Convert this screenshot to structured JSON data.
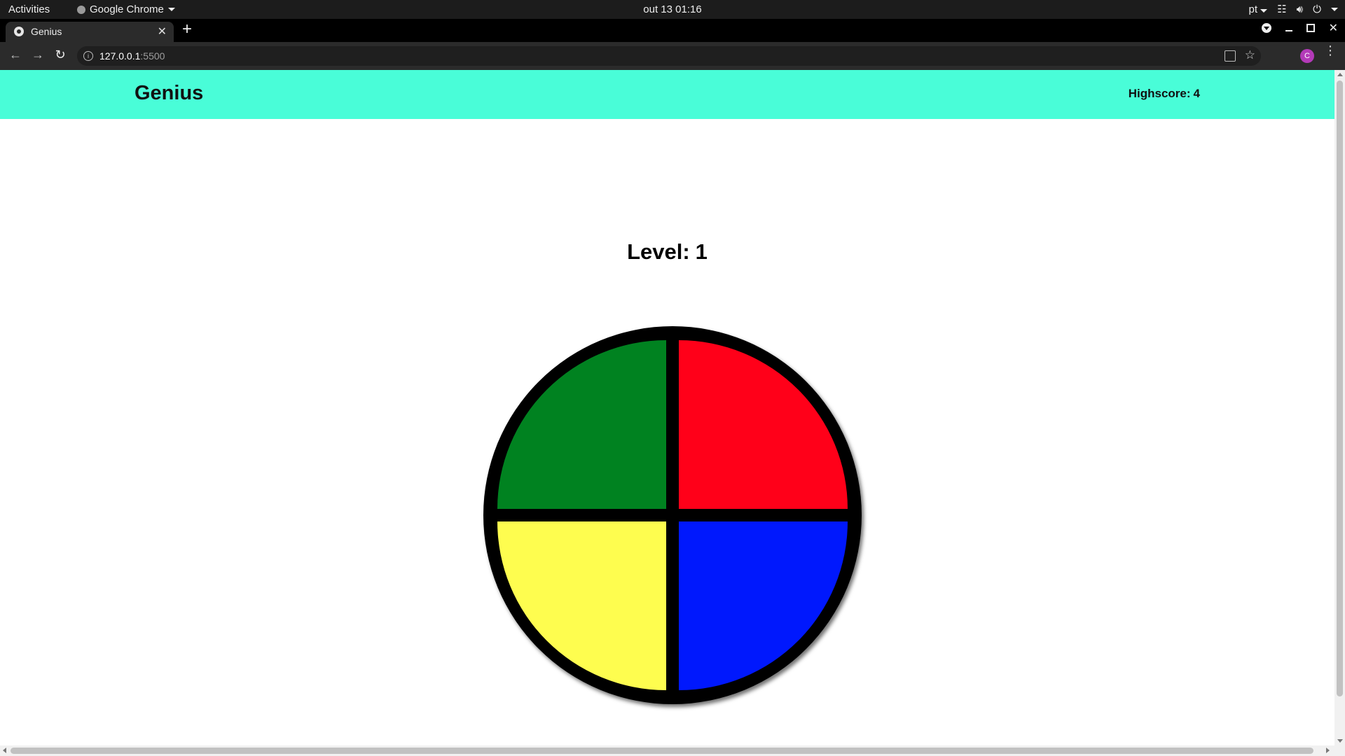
{
  "os": {
    "activities": "Activities",
    "app_name": "Google Chrome",
    "clock": "out 13  01:16",
    "language": "pt"
  },
  "browser": {
    "tab_title": "Genius",
    "url_host": "127.0.0.1",
    "url_port": ":5500",
    "profile_initial": "C",
    "icons": {
      "back": "back-arrow-icon",
      "forward": "forward-arrow-icon",
      "reload": "reload-icon",
      "info": "info-icon",
      "translate": "translate-icon",
      "bookmark": "star-icon",
      "menu": "kebab-menu-icon",
      "close_tab": "close-icon",
      "new_tab": "plus-icon"
    }
  },
  "page": {
    "title": "Genius",
    "highscore_label": "Highscore:",
    "highscore_value": "4",
    "level_label": "Level:",
    "level_value": "1",
    "header_color": "#49fdd8",
    "quadrants": [
      {
        "name": "green",
        "color": "#008220"
      },
      {
        "name": "red",
        "color": "#ff0019"
      },
      {
        "name": "yellow",
        "color": "#fefd4f"
      },
      {
        "name": "blue",
        "color": "#0018fd"
      }
    ]
  }
}
